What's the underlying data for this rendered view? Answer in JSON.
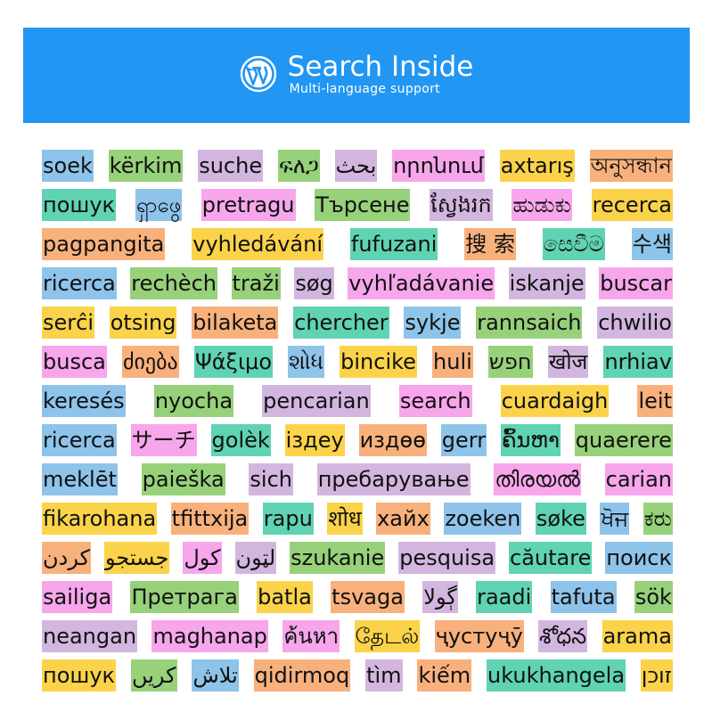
{
  "banner": {
    "title": "Search Inside",
    "subtitle": "Multi-language support",
    "logo_icon": "wordpress-logo-icon",
    "background_color": "#2196f3"
  },
  "colors": {
    "blue": "#8ec3ea",
    "green": "#97d17a",
    "lav": "#d3b6df",
    "pink": "#f7a6ec",
    "yellow": "#fbd34a",
    "orange": "#f8b17c",
    "teal": "#5fd3b4"
  },
  "rows": [
    [
      {
        "text": "soek",
        "color": "blue"
      },
      {
        "text": "kërkim",
        "color": "green"
      },
      {
        "text": "suche",
        "color": "lav"
      },
      {
        "text": "ፍለጋ",
        "color": "green"
      },
      {
        "text": "بحث",
        "color": "lav"
      },
      {
        "text": "որոնում",
        "color": "pink"
      },
      {
        "text": "axtarış",
        "color": "yellow"
      },
      {
        "text": "অনুসন্ধান",
        "color": "orange"
      }
    ],
    [
      {
        "text": "пошук",
        "color": "teal"
      },
      {
        "text": "ရှာဖွေ",
        "color": "blue"
      },
      {
        "text": "pretragu",
        "color": "pink"
      },
      {
        "text": "Търсене",
        "color": "green"
      },
      {
        "text": "ស្វែងរក",
        "color": "lav"
      },
      {
        "text": "ಹುಡುಕು",
        "color": "pink"
      },
      {
        "text": "recerca",
        "color": "yellow"
      }
    ],
    [
      {
        "text": "pagpangita",
        "color": "orange"
      },
      {
        "text": "vyhledávání",
        "color": "yellow"
      },
      {
        "text": "fufuzani",
        "color": "teal"
      },
      {
        "text": "搜 索",
        "color": "orange"
      },
      {
        "text": "සෙවීම",
        "color": "teal"
      },
      {
        "text": "수색",
        "color": "blue"
      }
    ],
    [
      {
        "text": "ricerca",
        "color": "blue"
      },
      {
        "text": "rechèch",
        "color": "green"
      },
      {
        "text": "traži",
        "color": "green"
      },
      {
        "text": "søg",
        "color": "lav"
      },
      {
        "text": "vyhľadávanie",
        "color": "pink"
      },
      {
        "text": "iskanje",
        "color": "lav"
      },
      {
        "text": "buscar",
        "color": "pink"
      }
    ],
    [
      {
        "text": "serĉi",
        "color": "yellow"
      },
      {
        "text": "otsing",
        "color": "yellow"
      },
      {
        "text": "bilaketa",
        "color": "orange"
      },
      {
        "text": "chercher",
        "color": "teal"
      },
      {
        "text": "sykje",
        "color": "blue"
      },
      {
        "text": "rannsaich",
        "color": "green"
      },
      {
        "text": "chwilio",
        "color": "lav"
      }
    ],
    [
      {
        "text": "busca",
        "color": "pink"
      },
      {
        "text": "ძიება",
        "color": "orange"
      },
      {
        "text": "Ψάξιμο",
        "color": "teal"
      },
      {
        "text": "શોધ",
        "color": "blue"
      },
      {
        "text": "bincike",
        "color": "yellow"
      },
      {
        "text": "huli",
        "color": "orange"
      },
      {
        "text": "חפש",
        "color": "green"
      },
      {
        "text": "खोज",
        "color": "lav"
      },
      {
        "text": "nrhiav",
        "color": "teal"
      }
    ],
    [
      {
        "text": "keresés",
        "color": "blue"
      },
      {
        "text": "nyocha",
        "color": "green"
      },
      {
        "text": "pencarian",
        "color": "lav"
      },
      {
        "text": "search",
        "color": "pink"
      },
      {
        "text": "cuardaigh",
        "color": "yellow"
      },
      {
        "text": "leit",
        "color": "orange"
      }
    ],
    [
      {
        "text": "ricerca",
        "color": "blue"
      },
      {
        "text": "サーチ",
        "color": "pink"
      },
      {
        "text": "golèk",
        "color": "teal"
      },
      {
        "text": "іздеу",
        "color": "yellow"
      },
      {
        "text": "издөө",
        "color": "orange"
      },
      {
        "text": "gerr",
        "color": "blue"
      },
      {
        "text": "ຄົ້ນຫາ",
        "color": "teal"
      },
      {
        "text": "quaerere",
        "color": "green"
      }
    ],
    [
      {
        "text": "meklēt",
        "color": "blue"
      },
      {
        "text": "paieška",
        "color": "green"
      },
      {
        "text": "sich",
        "color": "lav"
      },
      {
        "text": "пребарување",
        "color": "lav"
      },
      {
        "text": "തിരയൽ",
        "color": "pink"
      },
      {
        "text": "carian",
        "color": "pink"
      }
    ],
    [
      {
        "text": "fikarohana",
        "color": "yellow"
      },
      {
        "text": "tfittxija",
        "color": "orange"
      },
      {
        "text": "rapu",
        "color": "teal"
      },
      {
        "text": "शोध",
        "color": "yellow"
      },
      {
        "text": "хайх",
        "color": "orange"
      },
      {
        "text": "zoeken",
        "color": "blue"
      },
      {
        "text": "søke",
        "color": "teal"
      },
      {
        "text": "ਖੋਜ",
        "color": "blue"
      },
      {
        "text": "ಕರು",
        "color": "green"
      }
    ],
    [
      {
        "text": "کردن",
        "color": "orange"
      },
      {
        "text": "جستجو",
        "color": "yellow"
      },
      {
        "text": "کول",
        "color": "pink"
      },
      {
        "text": "لټون",
        "color": "lav"
      },
      {
        "text": "szukanie",
        "color": "green"
      },
      {
        "text": "pesquisa",
        "color": "lav"
      },
      {
        "text": "căutare",
        "color": "teal"
      },
      {
        "text": "поиск",
        "color": "blue"
      }
    ],
    [
      {
        "text": "sailiga",
        "color": "pink"
      },
      {
        "text": "Претрага",
        "color": "green"
      },
      {
        "text": "batla",
        "color": "yellow"
      },
      {
        "text": "tsvaga",
        "color": "orange"
      },
      {
        "text": "ڳولا",
        "color": "lav"
      },
      {
        "text": "raadi",
        "color": "teal"
      },
      {
        "text": "tafuta",
        "color": "blue"
      },
      {
        "text": "sök",
        "color": "green"
      }
    ],
    [
      {
        "text": "neangan",
        "color": "lav"
      },
      {
        "text": "maghanap",
        "color": "pink"
      },
      {
        "text": "ค้นหา",
        "color": "pink"
      },
      {
        "text": "தேடல்",
        "color": "yellow"
      },
      {
        "text": "ҷустуҷӯ",
        "color": "orange"
      },
      {
        "text": "శోధన",
        "color": "lav"
      },
      {
        "text": "arama",
        "color": "yellow"
      }
    ],
    [
      {
        "text": "пошук",
        "color": "yellow"
      },
      {
        "text": "کریں",
        "color": "green"
      },
      {
        "text": "تلاش",
        "color": "blue"
      },
      {
        "text": "qidirmoq",
        "color": "orange"
      },
      {
        "text": "tìm",
        "color": "lav"
      },
      {
        "text": "kiếm",
        "color": "orange"
      },
      {
        "text": "ukukhangela",
        "color": "teal"
      },
      {
        "text": "זוכן",
        "color": "yellow"
      }
    ]
  ]
}
